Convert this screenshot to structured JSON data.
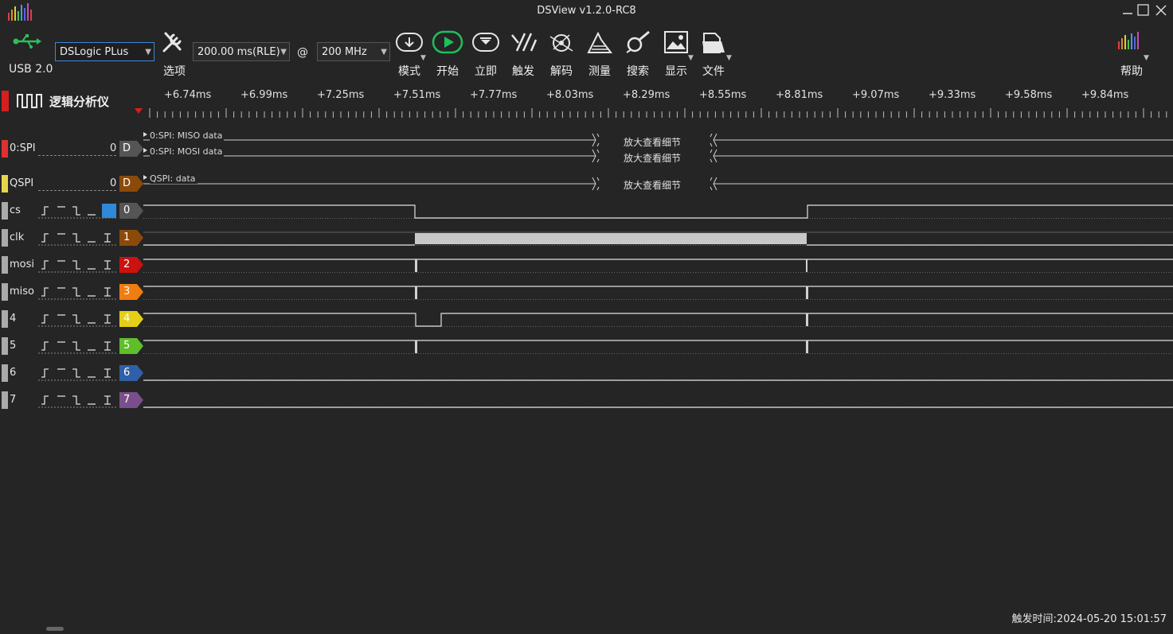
{
  "window": {
    "title": "DSView v1.2.0-RC8"
  },
  "toolbar": {
    "usb_label": "USB 2.0",
    "device": "DSLogic PLus",
    "options_label": "选项",
    "duration": "200.00 ms(RLE)",
    "at": "@",
    "samplerate": "200 MHz",
    "mode_label": "模式",
    "start_label": "开始",
    "instant_label": "立即",
    "trigger_label": "触发",
    "decode_label": "解码",
    "measure_label": "测量",
    "search_label": "搜索",
    "display_label": "显示",
    "file_label": "文件",
    "help_label": "帮助"
  },
  "ruler": {
    "title": "逻辑分析仪",
    "ticks": [
      "+6.74ms",
      "+6.99ms",
      "+7.25ms",
      "+7.51ms",
      "+7.77ms",
      "+8.03ms",
      "+8.29ms",
      "+8.55ms",
      "+8.81ms",
      "+9.07ms",
      "+9.33ms",
      "+9.58ms",
      "+9.84ms"
    ]
  },
  "decoders": [
    {
      "name": "0:SPI",
      "index": "0",
      "badge": "D",
      "color": "#e03030",
      "rows": [
        {
          "label": "0:SPI: MISO data",
          "zoom": "放大查看细节"
        },
        {
          "label": "0:SPI: MOSI data",
          "zoom": "放大查看细节"
        }
      ]
    },
    {
      "name": "QSPI",
      "index": "0",
      "badge": "D",
      "color": "#e8d44d",
      "rows": [
        {
          "label": "QSPI: data",
          "zoom": "放大查看细节"
        }
      ]
    }
  ],
  "channels": [
    {
      "name": "cs",
      "num": "0",
      "color": "#555555"
    },
    {
      "name": "clk",
      "num": "1",
      "color": "#8b4a0a"
    },
    {
      "name": "mosi",
      "num": "2",
      "color": "#cc1111"
    },
    {
      "name": "miso",
      "num": "3",
      "color": "#ef7d10"
    },
    {
      "name": "4",
      "num": "4",
      "color": "#e3cf18"
    },
    {
      "name": "5",
      "num": "5",
      "color": "#5fbe2a"
    },
    {
      "name": "6",
      "num": "6",
      "color": "#2f5fa8"
    },
    {
      "name": "7",
      "num": "7",
      "color": "#7a4e8c"
    }
  ],
  "footer": {
    "trigger_time": "触发时间:2024-05-20 15:01:57"
  }
}
